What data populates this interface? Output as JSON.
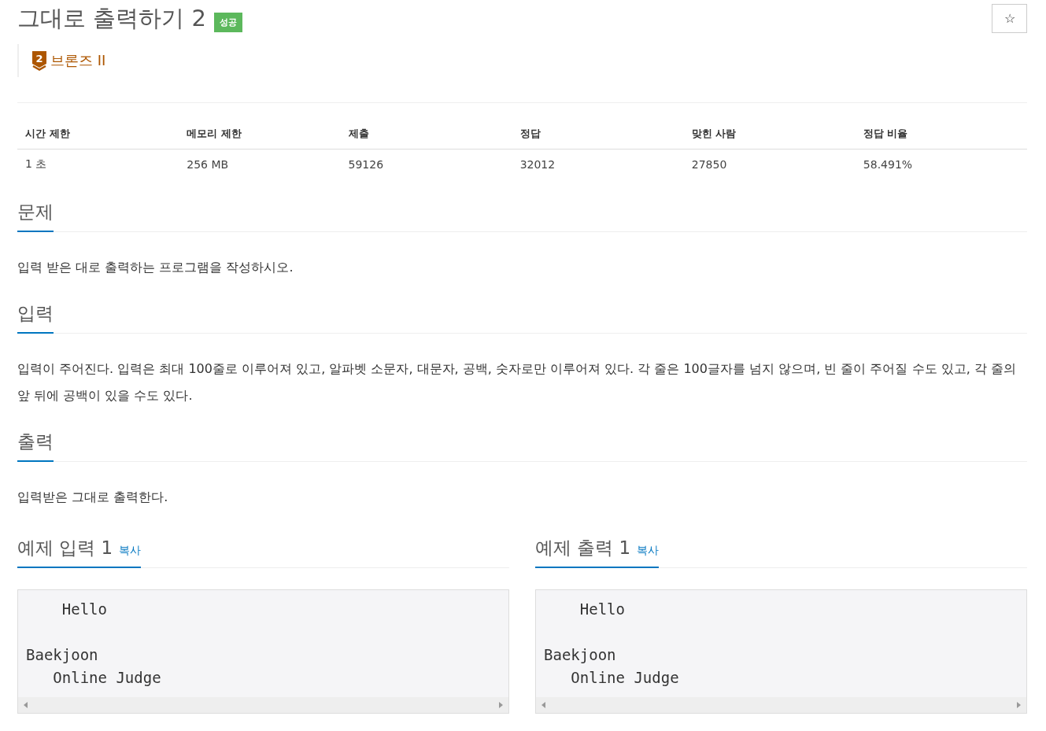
{
  "title": "그대로 출력하기 2",
  "result_badge": "성공",
  "star_button": "☆",
  "tier": {
    "number": "2",
    "label": "브론즈 II"
  },
  "info_table": {
    "columns": [
      "시간 제한",
      "메모리 제한",
      "제출",
      "정답",
      "맞힌 사람",
      "정답 비율"
    ],
    "rows": [
      [
        "1 초",
        "256 MB",
        "59126",
        "32012",
        "27850",
        "58.491%"
      ]
    ]
  },
  "sections": [
    {
      "heading": "문제",
      "text": "입력 받은 대로 출력하는 프로그램을 작성하시오."
    },
    {
      "heading": "입력",
      "text": "입력이 주어진다. 입력은 최대 100줄로 이루어져 있고, 알파벳 소문자, 대문자, 공백, 숫자로만 이루어져 있다. 각 줄은 100글자를 넘지 않으며, 빈 줄이 주어질 수도 있고, 각 줄의 앞 뒤에 공백이 있을 수도 있다."
    },
    {
      "heading": "출력",
      "text": "입력받은 그대로 출력한다."
    }
  ],
  "samples": [
    {
      "heading": "예제 입력 1",
      "copy": "복사",
      "content": "    Hello\n\nBaekjoon\n   Online Judge"
    },
    {
      "heading": "예제 출력 1",
      "copy": "복사",
      "content": "    Hello\n\nBaekjoon\n   Online Judge"
    }
  ]
}
